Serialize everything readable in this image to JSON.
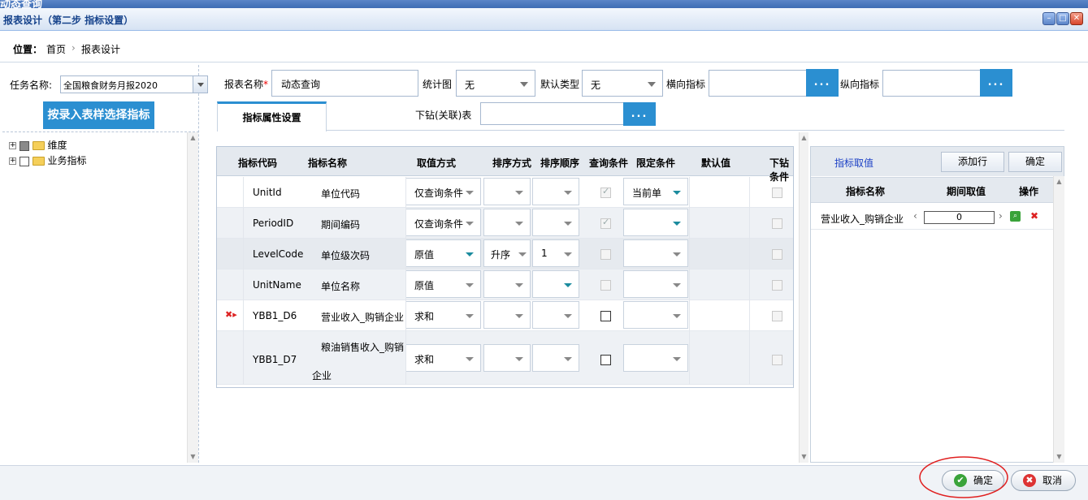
{
  "outer_title": "动态查询",
  "window": {
    "title": "报表设计（第二步 指标设置）"
  },
  "breadcrumb": {
    "label": "位置：",
    "home": "首页",
    "sep": "›",
    "current": "报表设计"
  },
  "left": {
    "task_label": "任务名称:",
    "task_value": "全国粮食财务月报2020",
    "select_btn": "按录入表样选择指标",
    "tree": [
      {
        "label": "维度",
        "checked": "partial"
      },
      {
        "label": "业务指标",
        "checked": "none"
      }
    ]
  },
  "form": {
    "report_name_label": "报表名称",
    "required_star": "*",
    "report_name_value": "动态查询",
    "chart_label": "统计图",
    "chart_value": "无",
    "default_type_label": "默认类型",
    "default_type_value": "无",
    "h_index_label": "横向指标",
    "v_index_label": "纵向指标",
    "dots": "...",
    "drill_label": "下钻(关联)表"
  },
  "tab": {
    "label": "指标属性设置"
  },
  "grid": {
    "headers": [
      "指标代码",
      "指标名称",
      "取值方式",
      "排序方式",
      "排序顺序",
      "查询条件",
      "限定条件",
      "默认值",
      "下钻条件"
    ],
    "rows": [
      {
        "code": "UnitId",
        "name": "单位代码",
        "value_mode": "仅查询条件",
        "sort": "",
        "order": "",
        "query_checked": true,
        "query_style": "gray",
        "limit": "当前单",
        "limit_teal": true
      },
      {
        "code": "PeriodID",
        "name": "期间编码",
        "value_mode": "仅查询条件",
        "sort": "",
        "order": "",
        "query_checked": true,
        "query_style": "gray",
        "limit": "",
        "limit_teal": true
      },
      {
        "code": "LevelCode",
        "name": "单位级次码",
        "value_mode": "原值",
        "sort": "升序",
        "order": "1",
        "query_checked": false,
        "query_style": "gray",
        "limit": "",
        "limit_teal": false
      },
      {
        "code": "UnitName",
        "name": "单位名称",
        "value_mode": "原值",
        "sort": "",
        "order": "",
        "query_checked": false,
        "query_style": "gray",
        "limit": "",
        "limit_teal": false
      },
      {
        "code": "YBB1_D6",
        "name": "营业收入_购销企业",
        "value_mode": "求和",
        "sort": "",
        "order": "",
        "query_checked": false,
        "query_style": "dark",
        "limit": "",
        "limit_teal": false
      },
      {
        "code": "YBB1_D7",
        "name_line1": "粮油销售收入_购销",
        "name_line2": "企业",
        "value_mode": "求和",
        "sort": "",
        "order": "",
        "query_checked": false,
        "query_style": "dark",
        "limit": "",
        "limit_teal": false
      }
    ]
  },
  "right": {
    "title": "指标取值",
    "add_row": "添加行",
    "confirm": "确定",
    "col_name": "指标名称",
    "col_period": "期间取值",
    "col_action": "操作",
    "row_name": "营业收入_购销企业",
    "row_value": "0",
    "prev": "‹",
    "next": "›"
  },
  "bottom": {
    "ok": "确定",
    "cancel": "取消"
  },
  "colors": {
    "accent": "#2b8fd1",
    "title_text": "#15428b",
    "annotation": "#e02020"
  }
}
